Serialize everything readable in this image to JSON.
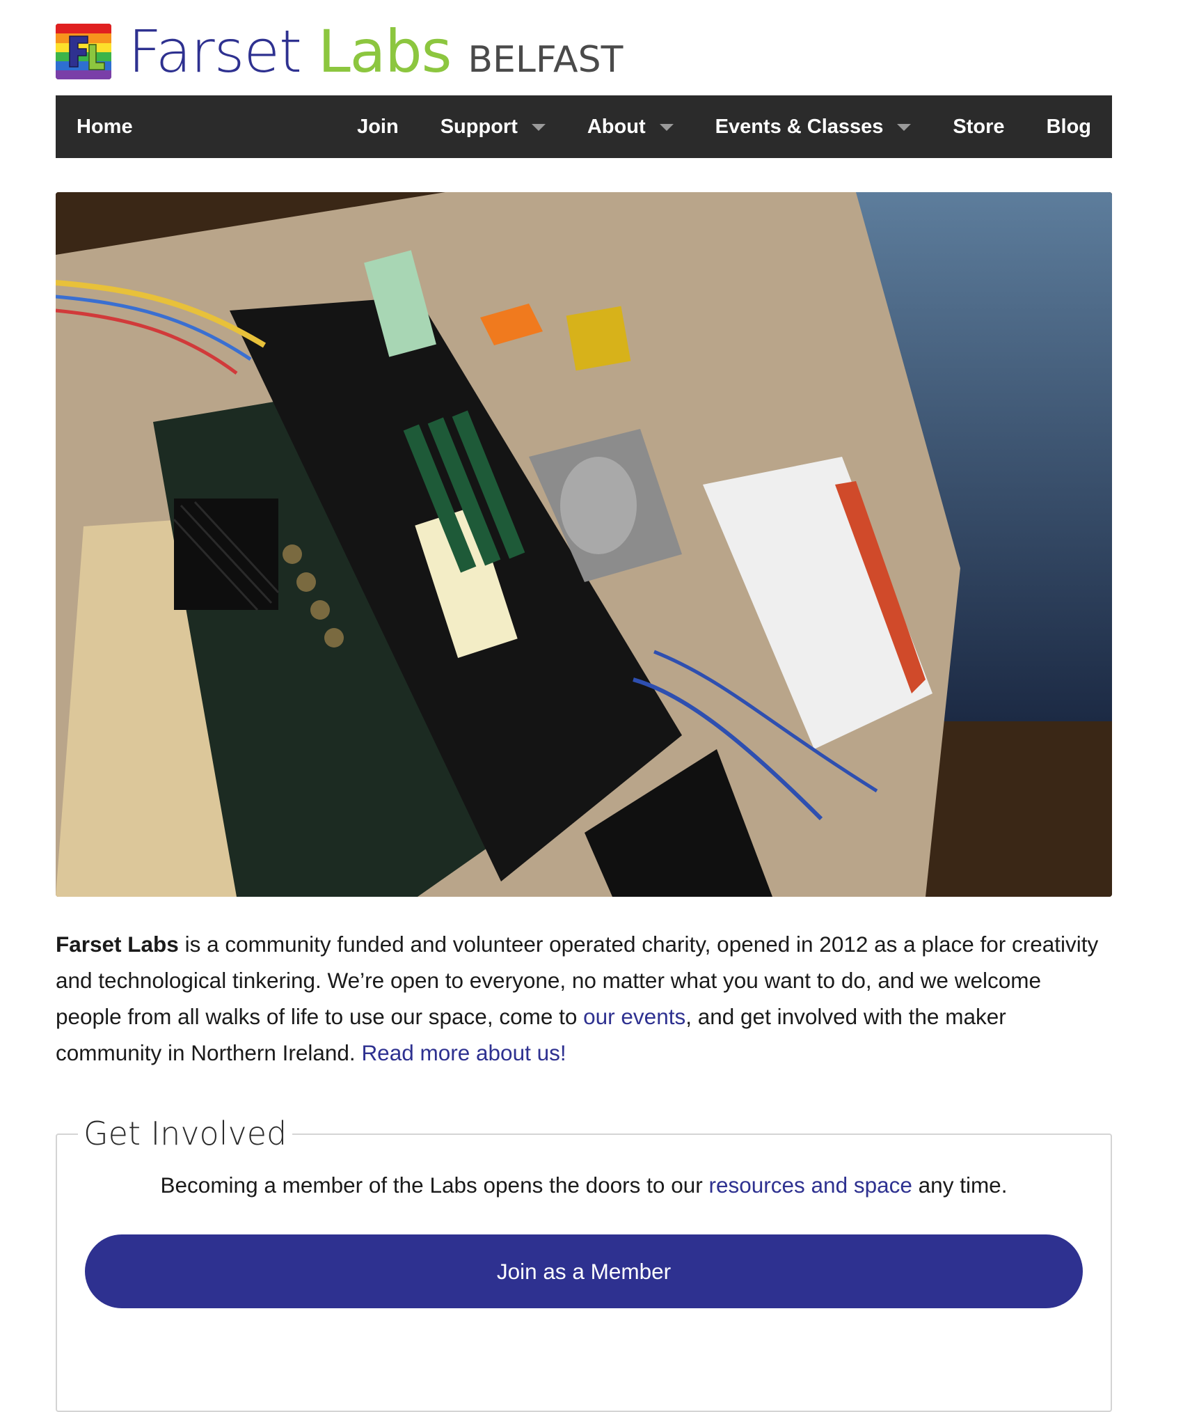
{
  "brand": {
    "name_part1": "Farset",
    "name_part2": "Labs",
    "city": "BELFAST",
    "colors": {
      "primary": "#2e3190",
      "accent": "#8cc63f",
      "nav_bg": "#2b2b2b"
    }
  },
  "nav": {
    "home": "Home",
    "items": [
      {
        "label": "Join",
        "dropdown": false
      },
      {
        "label": "Support",
        "dropdown": true
      },
      {
        "label": "About",
        "dropdown": true
      },
      {
        "label": "Events & Classes",
        "dropdown": true
      },
      {
        "label": "Store",
        "dropdown": false
      },
      {
        "label": "Blog",
        "dropdown": false
      }
    ]
  },
  "intro": {
    "bold_name": "Farset Labs",
    "text1": " is a community funded and volunteer operated charity, opened in 2012 as a place for creativity and technological tinkering. We’re open to everyone, no matter what you want to do, and we welcome people from all walks of life to use our space, come to ",
    "link_events": "our events",
    "text2": ", and get involved with the maker community in Northern Ireland. ",
    "link_about": "Read more about us!"
  },
  "get_involved": {
    "legend": "Get Involved",
    "text_before": "Becoming a member of the Labs opens the doors to our ",
    "link_resources": "resources and space",
    "text_after": " any time.",
    "button": "Join as a Member"
  }
}
